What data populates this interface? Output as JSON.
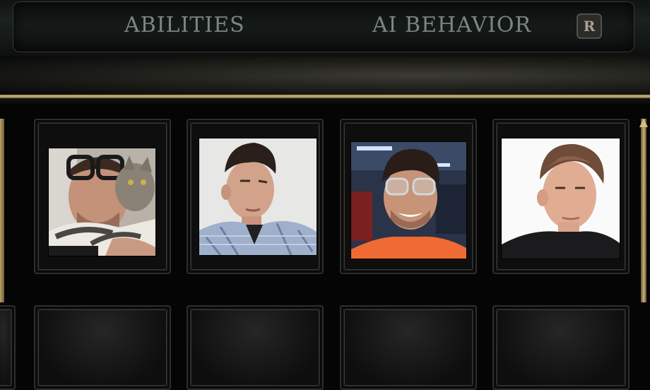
{
  "tabs": [
    {
      "label": "ABILITIES"
    },
    {
      "label": "AI BEHAVIOR"
    }
  ],
  "badge": {
    "label": "R"
  },
  "colors": {
    "gold": "#c8b579",
    "tab_text": "#7b8683"
  },
  "portraits": [
    {
      "name": "portrait-person-with-cat"
    },
    {
      "name": "portrait-person-plaid-shirt"
    },
    {
      "name": "portrait-person-glasses-orange"
    },
    {
      "name": "portrait-person-white-background"
    }
  ]
}
